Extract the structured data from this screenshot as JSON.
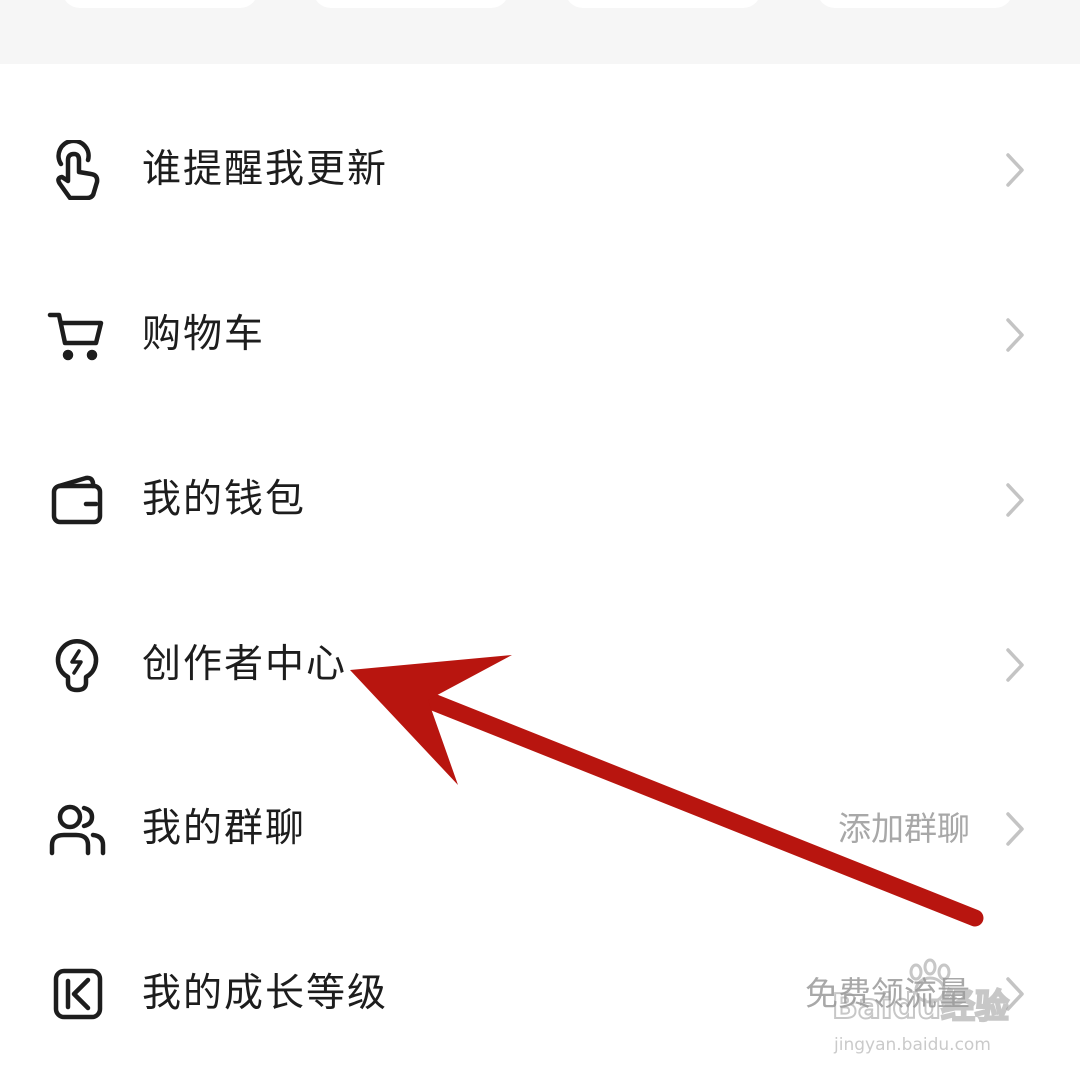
{
  "menu": {
    "items": [
      {
        "label": "谁提醒我更新",
        "icon": "tap-hand-icon",
        "hint": ""
      },
      {
        "label": "购物车",
        "icon": "shopping-cart-icon",
        "hint": ""
      },
      {
        "label": "我的钱包",
        "icon": "wallet-icon",
        "hint": ""
      },
      {
        "label": "创作者中心",
        "icon": "lightbulb-icon",
        "hint": ""
      },
      {
        "label": "我的群聊",
        "icon": "group-users-icon",
        "hint": "添加群聊"
      },
      {
        "label": "我的成长等级",
        "icon": "kuaishou-k-icon",
        "hint": "免费领流量"
      }
    ]
  },
  "annotation": {
    "color": "#b8150f",
    "points_to": "创作者中心"
  },
  "watermark": {
    "brand": "Baidu经验",
    "url": "jingyan.baidu.com"
  },
  "colors": {
    "text": "#1d1d1d",
    "hint": "#a8a8a8",
    "chevron": "#c4c4c4",
    "top_strip": "#f6f6f6"
  }
}
